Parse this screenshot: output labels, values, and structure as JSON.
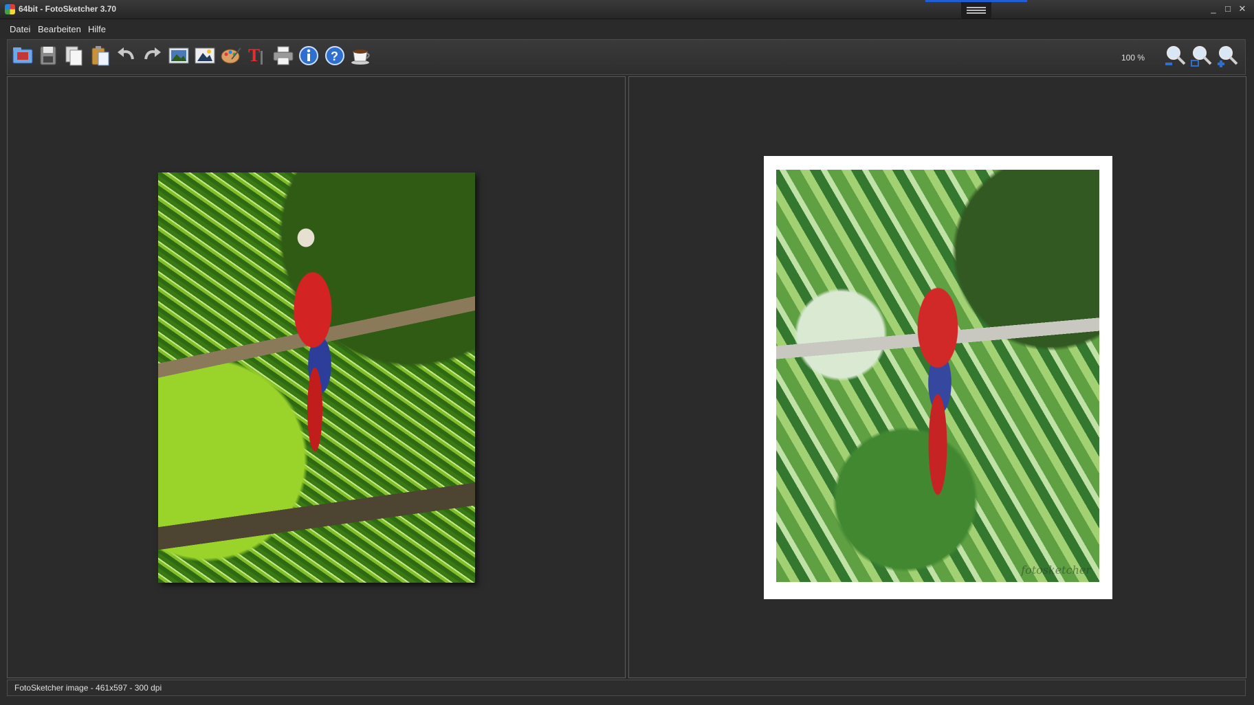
{
  "window": {
    "title": "64bit - FotoSketcher 3.70",
    "minimize_glyph": "_",
    "maximize_glyph": "□",
    "close_glyph": "✕"
  },
  "menu": {
    "items": [
      "Datei",
      "Bearbeiten",
      "Hilfe"
    ]
  },
  "toolbar": {
    "buttons": [
      {
        "icon": "open-image-icon"
      },
      {
        "icon": "save-icon"
      },
      {
        "icon": "copy-icon"
      },
      {
        "icon": "paste-icon"
      },
      {
        "icon": "undo-icon"
      },
      {
        "icon": "redo-icon"
      },
      {
        "icon": "original-image-icon"
      },
      {
        "icon": "result-image-icon"
      },
      {
        "icon": "paint-palette-icon"
      },
      {
        "icon": "text-tool-icon"
      },
      {
        "icon": "print-icon"
      },
      {
        "icon": "info-icon"
      },
      {
        "icon": "help-icon"
      },
      {
        "icon": "coffee-cup-icon"
      }
    ],
    "zoom_level": "100 %",
    "zoom_buttons": [
      {
        "icon": "zoom-out-icon"
      },
      {
        "icon": "zoom-reset-icon"
      },
      {
        "icon": "zoom-in-icon"
      }
    ]
  },
  "panels": {
    "left": {
      "content": "original-photo"
    },
    "right": {
      "content": "sketch-result",
      "watermark": "fotosketcher"
    }
  },
  "status": {
    "text": "FotoSketcher image - 461x597 - 300 dpi"
  },
  "colors": {
    "background": "#2b2b2b",
    "accent": "#1f5ed6"
  }
}
